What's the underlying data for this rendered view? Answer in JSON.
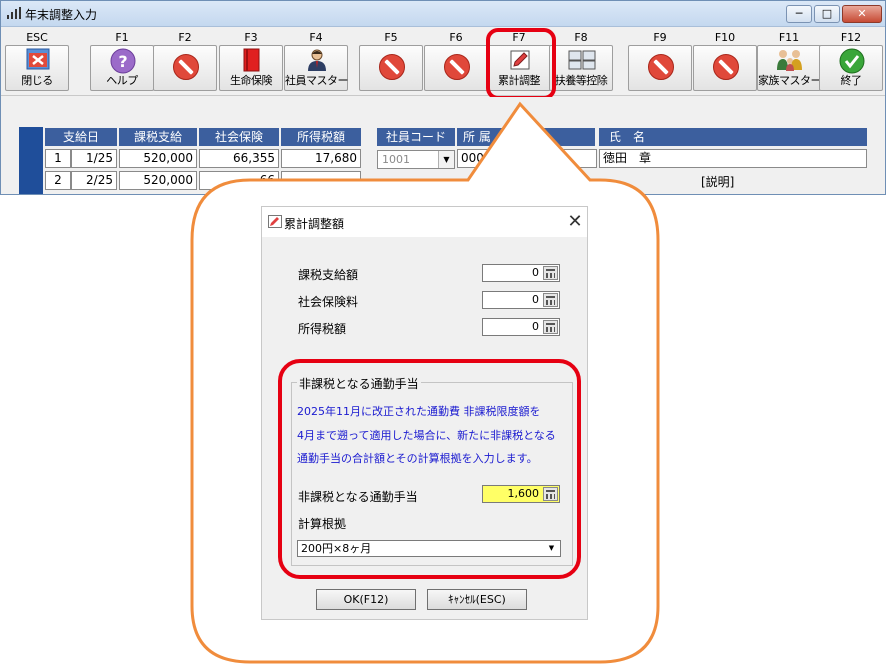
{
  "window": {
    "title": "年末調整入力",
    "min_symbol": "─",
    "max_symbol": "□",
    "close_symbol": "✕"
  },
  "toolbar": {
    "keys": [
      {
        "key": "ESC",
        "label": "閉じる",
        "icon": "close-window-icon"
      },
      {
        "key": "F1",
        "label": "ヘルプ",
        "icon": "help-icon"
      },
      {
        "key": "F2",
        "label": "",
        "icon": "disabled-icon"
      },
      {
        "key": "F3",
        "label": "生命保険",
        "icon": "book-icon"
      },
      {
        "key": "F4",
        "label": "社員マスター",
        "icon": "person-icon"
      },
      {
        "key": "F5",
        "label": "",
        "icon": "disabled-icon"
      },
      {
        "key": "F6",
        "label": "",
        "icon": "disabled-icon"
      },
      {
        "key": "F7",
        "label": "累計調整",
        "icon": "pencil-edit-icon"
      },
      {
        "key": "F8",
        "label": "扶養等控除",
        "icon": "monitors-icon"
      },
      {
        "key": "F9",
        "label": "",
        "icon": "disabled-icon"
      },
      {
        "key": "F10",
        "label": "",
        "icon": "disabled-icon"
      },
      {
        "key": "F11",
        "label": "家族マスター",
        "icon": "family-icon"
      },
      {
        "key": "F12",
        "label": "終了",
        "icon": "check-icon"
      }
    ]
  },
  "pay_table": {
    "headers": [
      "支給日",
      "課税支給",
      "社会保険",
      "所得税額"
    ],
    "rows": [
      {
        "no": "1",
        "date": "1/25",
        "taxable": "520,000",
        "social": "66,355",
        "tax": "17,680"
      },
      {
        "no": "2",
        "date": "2/25",
        "taxable": "520,000",
        "social": "66",
        "tax": ""
      }
    ]
  },
  "employee": {
    "headers": {
      "code": "社員コード",
      "dept": "所 属",
      "name": "氏　名"
    },
    "code_value": "1001",
    "dept_value": "000",
    "name_value": "徳田　章",
    "explain_link": "[説明]"
  },
  "dialog": {
    "title": "累計調整額",
    "close_symbol": "✕",
    "fields": [
      {
        "label": "課税支給額",
        "value": "0"
      },
      {
        "label": "社会保険料",
        "value": "0"
      },
      {
        "label": "所得税額",
        "value": "0"
      }
    ],
    "group": {
      "title": "非課税となる通勤手当",
      "notes": [
        "2025年11月に改正された通勤費 非課税限度額を",
        "4月まで遡って適用した場合に、新たに非課税となる",
        "通勤手当の合計額とその計算根拠を入力します。"
      ],
      "allowance_label": "非課税となる通勤手当",
      "allowance_value": "1,600",
      "basis_label": "計算根拠",
      "basis_value": "200円×8ヶ月"
    },
    "ok_label": "OK(F12)",
    "cancel_label": "ｷｬﾝｾﾙ(ESC)"
  },
  "colors": {
    "highlight": "#e60012",
    "balloon_border": "#f08c3c",
    "header_blue": "#3c5f9e",
    "note_blue": "#1a1ad0",
    "yellow_field": "#ffff66"
  }
}
